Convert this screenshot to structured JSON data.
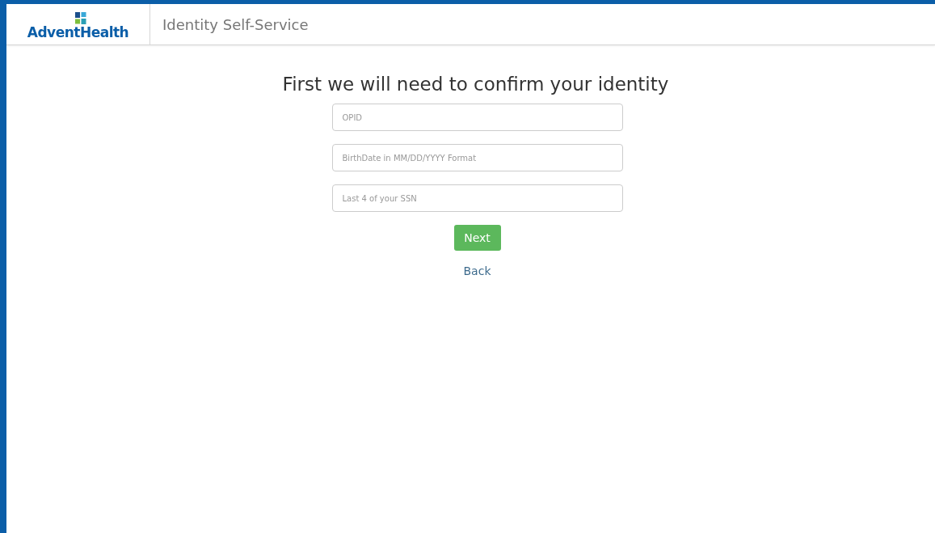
{
  "header": {
    "logo": "AdventHealth",
    "title": "Identity Self-Service"
  },
  "heading": "First we will need to confirm your identity",
  "fields": [
    {
      "placeholder": "OPID"
    },
    {
      "placeholder": "BirthDate in MM/DD/YYYY Format"
    },
    {
      "placeholder": "Last 4 of your SSN"
    }
  ],
  "next_button": "Next",
  "back_link": "Back"
}
